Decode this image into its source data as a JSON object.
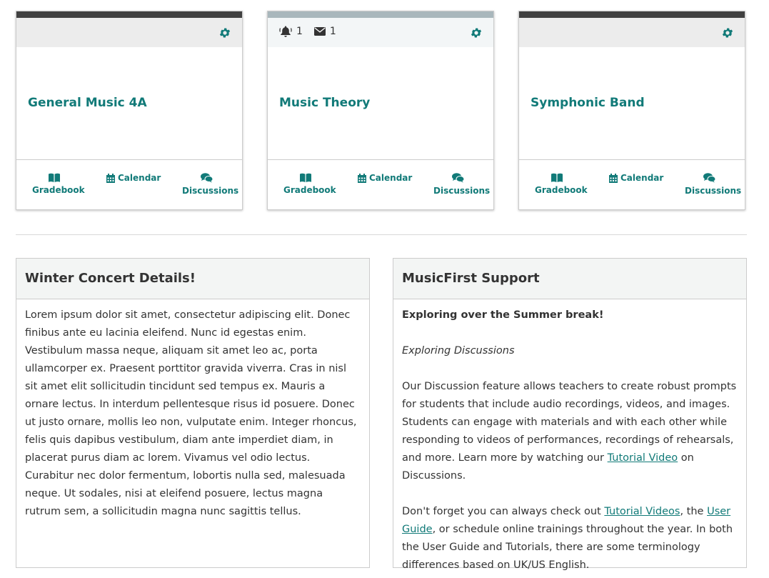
{
  "colors": {
    "teal": "#117a78",
    "dark_bar": "#404040",
    "light_bar": "#a9b7bc"
  },
  "cards": [
    {
      "title": "General Music 4A",
      "gradebook": "Gradebook",
      "calendar": "Calendar",
      "discussions": "Discussions"
    },
    {
      "title": "Music Theory",
      "alert_count": "1",
      "message_count": "1",
      "gradebook": "Gradebook",
      "calendar": "Calendar",
      "discussions": "Discussions"
    },
    {
      "title": "Symphonic Band",
      "gradebook": "Gradebook",
      "calendar": "Calendar",
      "discussions": "Discussions"
    }
  ],
  "winter": {
    "title": "Winter Concert Details!",
    "body": "Lorem ipsum dolor sit amet, consectetur adipiscing elit. Donec finibus ante eu lacinia eleifend. Nunc id egestas enim. Vestibulum massa neque, aliquam sit amet leo ac, porta ullamcorper ex. Praesent porttitor gravida viverra. Cras in nisl sit amet elit sollicitudin tincidunt sed tempus ex. Mauris a ornare lectus. In interdum pellentesque risus id posuere. Donec ut justo ornare, mollis leo non, vulputate enim. Integer rhoncus, felis quis dapibus vestibulum, diam ante imperdiet diam, in placerat purus diam ac lorem. Vivamus vel odio lectus. Curabitur nec dolor fermentum, lobortis nulla sed, malesuada neque. Ut sodales, nisi at eleifend posuere, lectus magna rutrum sem, a sollicitudin magna nunc sagittis tellus."
  },
  "support": {
    "title": "MusicFirst Support",
    "heading": "Exploring over the Summer break!",
    "subheading": "Exploring Discussions",
    "p1_before": "Our Discussion feature allows teachers to create robust prompts for students that include audio recordings, videos, and images. Students can engage with materials and with each other while responding to videos of performances, recordings of rehearsals, and more. Learn more by watching our ",
    "p1_link": "Tutorial Video",
    "p1_after": " on Discussions.",
    "p2_before": "Don't forget you can always check out ",
    "p2_link1": "Tutorial Videos",
    "p2_mid": ", the ",
    "p2_link2": "User Guide",
    "p2_after": ", or schedule online trainings throughout the year. In both the User Guide and Tutorials, there are some terminology differences based on UK/US English."
  }
}
